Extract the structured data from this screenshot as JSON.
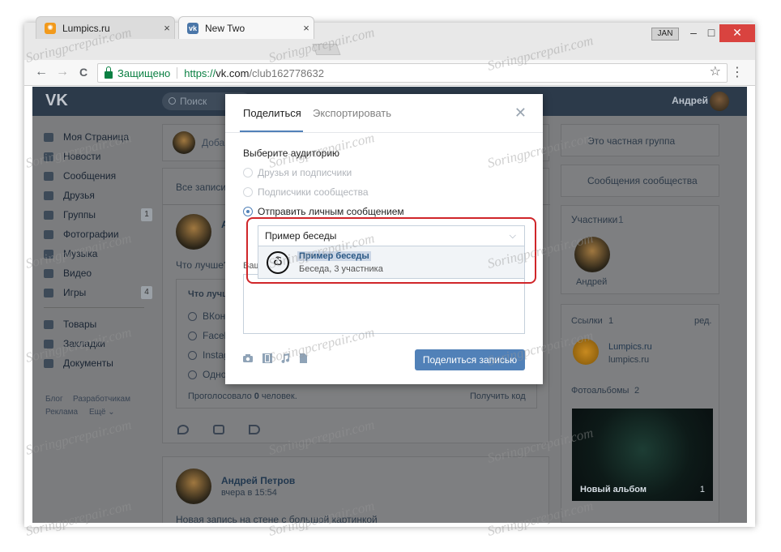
{
  "browser": {
    "tabs": [
      {
        "label": "Lumpics.ru",
        "close": "×"
      },
      {
        "label": "New Two",
        "close": "×"
      }
    ],
    "profile_badge": "JAN",
    "window_controls": {
      "minimize": "–",
      "maximize": "□",
      "close": "✕"
    },
    "secure_label": "Защищено",
    "url_scheme": "https://",
    "url_host": "vk.com",
    "url_path": "/club162778632",
    "star": "☆",
    "menu": "⋮",
    "back": "←",
    "forward": "→",
    "reload": "C"
  },
  "vk": {
    "logo": "VK",
    "search_placeholder": "Поиск",
    "user_name": "Андрей",
    "left_nav": [
      {
        "label": "Моя Страница"
      },
      {
        "label": "Новости"
      },
      {
        "label": "Сообщения"
      },
      {
        "label": "Друзья"
      },
      {
        "label": "Группы",
        "count": "1"
      },
      {
        "label": "Фотографии"
      },
      {
        "label": "Музыка"
      },
      {
        "label": "Видео"
      },
      {
        "label": "Игры",
        "count": "4"
      },
      {
        "label": "Товары"
      },
      {
        "label": "Закладки"
      },
      {
        "label": "Документы"
      }
    ],
    "footer_links": {
      "blog": "Блог",
      "dev": "Разработчикам",
      "ads": "Реклама",
      "more": "Ещё ⌄"
    },
    "feed": {
      "add_post_placeholder": "Доба",
      "all_posts_tab": "Все записи",
      "post1": {
        "author": "А",
        "text": "Что лучше?",
        "poll_title": "Что лучш",
        "poll_options": [
          "ВКон",
          "Faceb",
          "Instag",
          "Одно"
        ],
        "voted_prefix": "Проголосовало ",
        "voted_count": "0",
        "voted_suffix": " человек.",
        "get_code": "Получить код"
      },
      "post2": {
        "author": "Андрей Петров",
        "time": "вчера в 15:54",
        "text": "Новая запись на стене с большой картинкой"
      }
    },
    "right": {
      "private_group": "Это частная группа",
      "community_messages": "Сообщения сообщества",
      "members_title": "Участники",
      "members_count": "1",
      "member_name": "Андрей",
      "links_title": "Ссылки",
      "links_count": "1",
      "links_edit": "ред.",
      "link_name": "Lumpics.ru",
      "link_url": "lumpics.ru",
      "albums_title": "Фотоальбомы",
      "albums_count": "2",
      "album_name": "Новый альбом",
      "album_count": "1"
    }
  },
  "modal": {
    "tab_share": "Поделиться",
    "tab_export": "Экспортировать",
    "close": "✕",
    "audience_label": "Выберите аудиторию",
    "options": [
      {
        "label": "Друзья и подписчики"
      },
      {
        "label": "Подписчики сообщества"
      },
      {
        "label": "Отправить личным сообщением"
      }
    ],
    "selected_chat": "Пример беседы",
    "suggestion": {
      "name": "Пример беседы",
      "sub": "Беседа, 3 участника",
      "avatar_glyph": "ѽ"
    },
    "behind_label": "Ваш",
    "share_button": "Поделиться записью"
  },
  "watermark": "Soringpcrepair.com",
  "colors": {
    "accent": "#5181b8",
    "highlight": "#d0262a",
    "vk_header": "#2c3a4a"
  }
}
